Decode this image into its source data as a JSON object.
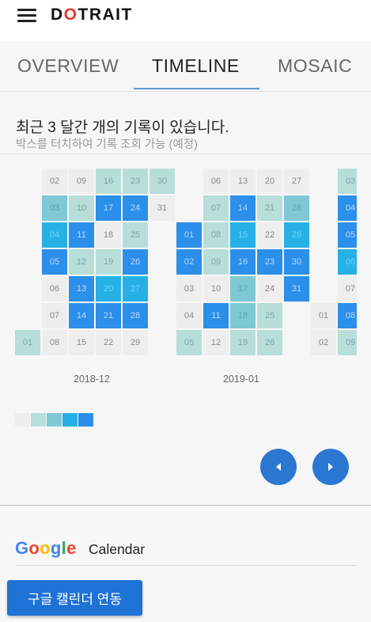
{
  "app": {
    "brand_prefix": "D",
    "brand_o": "O",
    "brand_suffix": "TRAIT"
  },
  "tabs": [
    {
      "label": "OVERVIEW",
      "active": false
    },
    {
      "label": "TIMELINE",
      "active": true
    },
    {
      "label": "MOSAIC",
      "active": false
    }
  ],
  "summary": {
    "text": "최근 3 달간 개의 기록이 있습니다.",
    "hint": "박스를 터치하여 기록 조회 가능 (예정)"
  },
  "months": [
    "2018-12",
    "2019-01"
  ],
  "colors": {
    "level0": "#eeeeee",
    "level1": "#b7ded9",
    "level2": "#7ec9d4",
    "level3": "#27b0e6",
    "level4": "#2c8fea",
    "accent": "#2b78d3"
  },
  "weeks": [
    [
      {
        "d": "",
        "l": -1
      },
      {
        "d": "",
        "l": -1
      },
      {
        "d": "",
        "l": -1
      },
      {
        "d": "",
        "l": -1
      },
      {
        "d": "",
        "l": -1
      },
      {
        "d": "",
        "l": -1
      },
      {
        "d": "01",
        "l": 1
      }
    ],
    [
      {
        "d": "02",
        "l": 0
      },
      {
        "d": "03",
        "l": 2
      },
      {
        "d": "04",
        "l": 3
      },
      {
        "d": "05",
        "l": 4
      },
      {
        "d": "06",
        "l": 0
      },
      {
        "d": "07",
        "l": 0
      },
      {
        "d": "08",
        "l": 0
      }
    ],
    [
      {
        "d": "09",
        "l": 0
      },
      {
        "d": "10",
        "l": 1
      },
      {
        "d": "11",
        "l": 4
      },
      {
        "d": "12",
        "l": 1
      },
      {
        "d": "13",
        "l": 4
      },
      {
        "d": "14",
        "l": 4
      },
      {
        "d": "15",
        "l": 0
      }
    ],
    [
      {
        "d": "16",
        "l": 1
      },
      {
        "d": "17",
        "l": 4
      },
      {
        "d": "18",
        "l": 0
      },
      {
        "d": "19",
        "l": 1
      },
      {
        "d": "20",
        "l": 3
      },
      {
        "d": "21",
        "l": 4
      },
      {
        "d": "22",
        "l": 0
      }
    ],
    [
      {
        "d": "23",
        "l": 1
      },
      {
        "d": "24",
        "l": 4
      },
      {
        "d": "25",
        "l": 1
      },
      {
        "d": "26",
        "l": 4
      },
      {
        "d": "27",
        "l": 3
      },
      {
        "d": "28",
        "l": 4
      },
      {
        "d": "29",
        "l": 0
      }
    ],
    [
      {
        "d": "30",
        "l": 1
      },
      {
        "d": "31",
        "l": 0
      },
      {
        "d": "",
        "l": -1
      },
      {
        "d": "",
        "l": -1
      },
      {
        "d": "",
        "l": -1
      },
      {
        "d": "",
        "l": -1
      },
      {
        "d": "",
        "l": -1
      }
    ],
    [
      {
        "d": "",
        "l": -1
      },
      {
        "d": "",
        "l": -1
      },
      {
        "d": "01",
        "l": 4
      },
      {
        "d": "02",
        "l": 4
      },
      {
        "d": "03",
        "l": 0
      },
      {
        "d": "04",
        "l": 0
      },
      {
        "d": "05",
        "l": 1
      }
    ],
    [
      {
        "d": "06",
        "l": 0
      },
      {
        "d": "07",
        "l": 1
      },
      {
        "d": "08",
        "l": 1
      },
      {
        "d": "09",
        "l": 1
      },
      {
        "d": "10",
        "l": 0
      },
      {
        "d": "11",
        "l": 4
      },
      {
        "d": "12",
        "l": 0
      }
    ],
    [
      {
        "d": "13",
        "l": 0
      },
      {
        "d": "14",
        "l": 4
      },
      {
        "d": "15",
        "l": 3
      },
      {
        "d": "16",
        "l": 4
      },
      {
        "d": "17",
        "l": 2
      },
      {
        "d": "18",
        "l": 2
      },
      {
        "d": "19",
        "l": 1
      }
    ],
    [
      {
        "d": "20",
        "l": 0
      },
      {
        "d": "21",
        "l": 1
      },
      {
        "d": "22",
        "l": 0
      },
      {
        "d": "23",
        "l": 4
      },
      {
        "d": "24",
        "l": 0
      },
      {
        "d": "25",
        "l": 1
      },
      {
        "d": "26",
        "l": 1
      }
    ],
    [
      {
        "d": "27",
        "l": 0
      },
      {
        "d": "28",
        "l": 2
      },
      {
        "d": "29",
        "l": 3
      },
      {
        "d": "30",
        "l": 4
      },
      {
        "d": "31",
        "l": 4
      },
      {
        "d": "",
        "l": -1
      },
      {
        "d": "",
        "l": -1
      }
    ],
    [
      {
        "d": "",
        "l": -1
      },
      {
        "d": "",
        "l": -1
      },
      {
        "d": "",
        "l": -1
      },
      {
        "d": "",
        "l": -1
      },
      {
        "d": "",
        "l": -1
      },
      {
        "d": "01",
        "l": 0
      },
      {
        "d": "02",
        "l": 0
      }
    ],
    [
      {
        "d": "03",
        "l": 1
      },
      {
        "d": "04",
        "l": 4
      },
      {
        "d": "05",
        "l": 4
      },
      {
        "d": "06",
        "l": 3
      },
      {
        "d": "07",
        "l": 0
      },
      {
        "d": "08",
        "l": 4
      },
      {
        "d": "09",
        "l": 1
      }
    ]
  ],
  "legend_levels": [
    0,
    1,
    2,
    3,
    4
  ],
  "nav": {
    "prev_icon": "chevron-left-icon",
    "next_icon": "chevron-right-icon"
  },
  "google": {
    "logo_letters": [
      {
        "ch": "G",
        "color": "#4285f4"
      },
      {
        "ch": "o",
        "color": "#ea4335"
      },
      {
        "ch": "o",
        "color": "#fbbc05"
      },
      {
        "ch": "g",
        "color": "#4285f4"
      },
      {
        "ch": "l",
        "color": "#34a853"
      },
      {
        "ch": "e",
        "color": "#ea4335"
      }
    ],
    "calendar_label": "Calendar",
    "button_label": "구글 캘린더 연동"
  }
}
